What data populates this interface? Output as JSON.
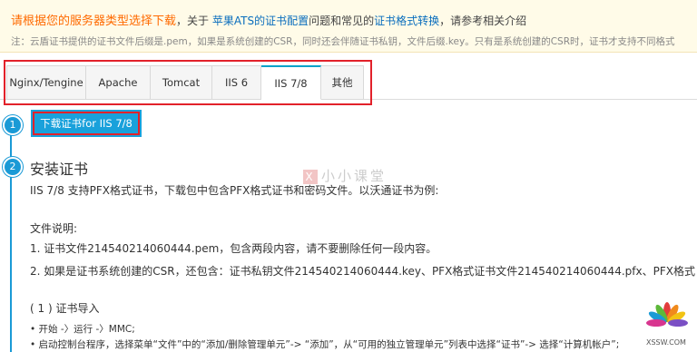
{
  "notice": {
    "line1_prefix": "请根据您的服务器类型选择下载",
    "line1_mid1": "，关于 ",
    "link_ats": "苹果ATS的证书配置",
    "line1_mid2": "问题和常见的",
    "link_format": "证书格式转换",
    "line1_suffix": "，请参考相关介绍",
    "line2": "注：云盾证书提供的证书文件后缀是.pem，如果是系统创建的CSR，同时还会伴随证书私钥，文件后缀.key。只有是系统创建的CSR时，证书才支持不同格式"
  },
  "tabs": [
    "Nginx/Tengine",
    "Apache",
    "Tomcat",
    "IIS 6",
    "IIS 7/8",
    "其他"
  ],
  "active_tab": "IIS 7/8",
  "steps": {
    "step1_num": "1",
    "step2_num": "2",
    "download_button": "下载证书for IIS 7/8",
    "title": "安装证书"
  },
  "content": {
    "intro": "IIS 7/8 支持PFX格式证书，下载包中包含PFX格式证书和密码文件。以沃通证书为例:",
    "file_desc": "文件说明:",
    "item1": "1. 证书文件214540214060444.pem，包含两段内容，请不要删除任何一段内容。",
    "item2": "2. 如果是证书系统创建的CSR，还包含：证书私钥文件214540214060444.key、PFX格式证书文件214540214060444.pfx、PFX格式",
    "section": "( 1 ) 证书导入",
    "bullet1": "• 开始 -〉运行 -〉MMC;",
    "bullet2": "• 启动控制台程序，选择菜单“文件”中的“添加/删除管理单元”-> “添加”，从“可用的独立管理单元”列表中选择“证书”-> 选择“计算机帐户”;"
  },
  "watermark": {
    "icon": "X",
    "text": "小小课堂"
  },
  "logo_text": "XSSW.COM",
  "colors": {
    "accent": "#19a1db",
    "highlight": "#e2212a",
    "notice_title": "#ff6a00",
    "link": "#0a6ebd"
  }
}
